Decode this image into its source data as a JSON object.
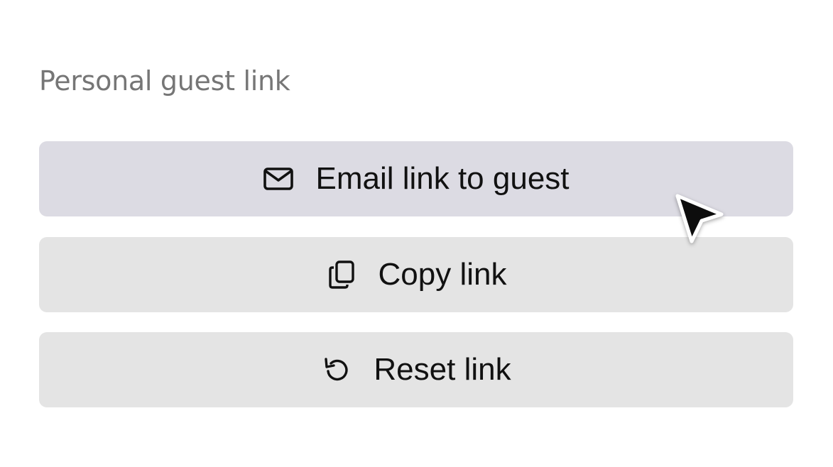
{
  "section": {
    "title": "Personal guest link"
  },
  "actions": [
    {
      "label": "Email link to guest",
      "icon": "envelope-icon",
      "state": "hover"
    },
    {
      "label": "Copy link",
      "icon": "copy-icon",
      "state": "default"
    },
    {
      "label": "Reset link",
      "icon": "reset-icon",
      "state": "default"
    }
  ],
  "colors": {
    "title_text": "#767676",
    "button_bg": "#e4e4e4",
    "button_hover_bg": "#dcdbe3",
    "button_text": "#111111"
  }
}
